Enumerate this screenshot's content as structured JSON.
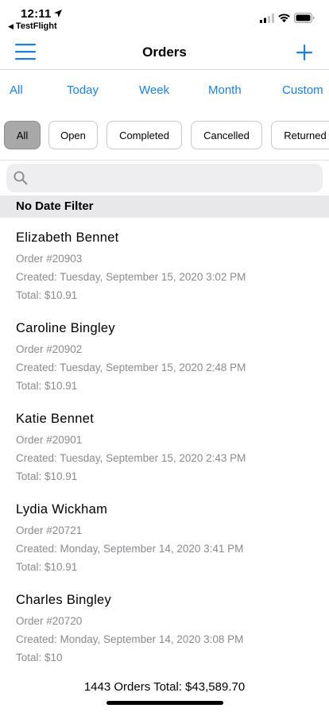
{
  "status_bar": {
    "time": "12:11",
    "back_app": "TestFlight"
  },
  "nav": {
    "title": "Orders"
  },
  "date_tabs": [
    "All",
    "Today",
    "Week",
    "Month",
    "Custom"
  ],
  "status_chips": [
    "All",
    "Open",
    "Completed",
    "Cancelled",
    "Returned"
  ],
  "active_chip": "All",
  "search": {
    "placeholder": "",
    "value": ""
  },
  "section_header": "No Date Filter",
  "orders": [
    {
      "name": "Elizabeth Bennet",
      "order": "Order #20903",
      "created": "Created: Tuesday, September 15, 2020 3:02 PM",
      "total": "Total: $10.91"
    },
    {
      "name": "Caroline Bingley",
      "order": "Order #20902",
      "created": "Created: Tuesday, September 15, 2020 2:48 PM",
      "total": "Total: $10.91"
    },
    {
      "name": "Katie Bennet",
      "order": "Order #20901",
      "created": "Created: Tuesday, September 15, 2020 2:43 PM",
      "total": "Total: $10.91"
    },
    {
      "name": "Lydia Wickham",
      "order": "Order #20721",
      "created": "Created: Monday, September 14, 2020 3:41 PM",
      "total": "Total: $10.91"
    },
    {
      "name": "Charles Bingley",
      "order": "Order #20720",
      "created": "Created: Monday, September 14, 2020 3:08 PM",
      "total": "Total: $10"
    }
  ],
  "footer": {
    "summary": "1443 Orders Total: $43,589.70"
  },
  "colors": {
    "accent": "#1a7fe0",
    "secondary_text": "#8a8a8e",
    "chip_active": "#a8a8a8",
    "section_bg": "#e8e8ea"
  },
  "icons": {
    "menu": "hamburger-icon",
    "add": "plus-icon",
    "search": "magnifier-icon",
    "location": "location-arrow-icon",
    "signal": "cellular-signal-icon",
    "wifi": "wifi-icon",
    "battery": "battery-icon"
  }
}
